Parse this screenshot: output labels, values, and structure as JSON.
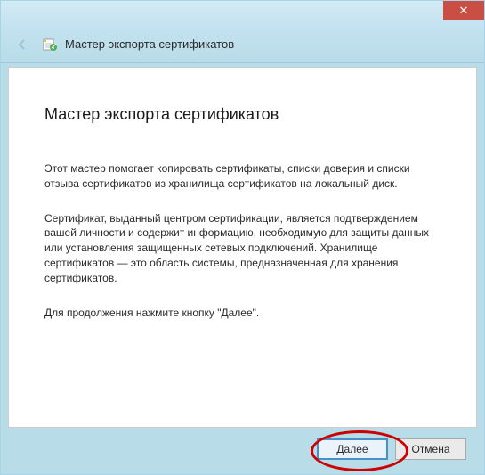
{
  "window": {
    "close_label": "✕"
  },
  "header": {
    "title": "Мастер экспорта сертификатов"
  },
  "content": {
    "heading": "Мастер экспорта сертификатов",
    "paragraph1": "Этот мастер помогает копировать сертификаты, списки доверия и списки отзыва сертификатов из хранилища сертификатов на локальный диск.",
    "paragraph2": "Сертификат, выданный центром сертификации, является подтверждением вашей личности и содержит информацию, необходимую для защиты данных или установления защищенных сетевых подключений. Хранилище сертификатов — это область системы, предназначенная для хранения сертификатов.",
    "paragraph3": "Для продолжения нажмите кнопку \"Далее\"."
  },
  "buttons": {
    "next": "Далее",
    "cancel": "Отмена"
  }
}
